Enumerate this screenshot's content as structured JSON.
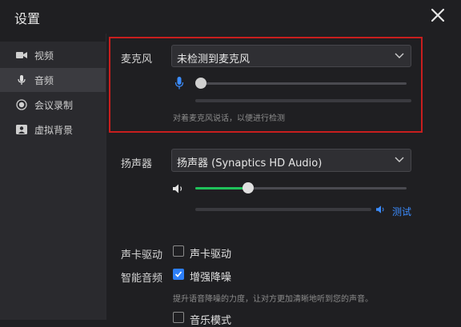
{
  "window": {
    "title": "设置"
  },
  "sidebar": {
    "items": [
      {
        "label": "视频",
        "icon": "video-camera-icon",
        "active": false
      },
      {
        "label": "音频",
        "icon": "microphone-icon",
        "active": true
      },
      {
        "label": "会议录制",
        "icon": "record-icon",
        "active": false
      },
      {
        "label": "虚拟背景",
        "icon": "portrait-icon",
        "active": false
      }
    ]
  },
  "microphone": {
    "label": "麦克风",
    "selected": "未检测到麦克风",
    "level": 0,
    "hint": "对着麦克风说话，以便进行检测"
  },
  "speaker": {
    "label": "扬声器",
    "selected": "扬声器 (Synaptics HD Audio)",
    "volume": 0.25,
    "test_label": "测试"
  },
  "sound_card": {
    "label": "声卡驱动",
    "checkbox_label": "声卡驱动",
    "checked": false
  },
  "smart_audio": {
    "label": "智能音频",
    "checkbox_label": "增强降噪",
    "checked": true,
    "hint": "提升语音降噪的力度，让对方更加清晰地听到您的声音。"
  },
  "music_mode": {
    "checkbox_label": "音乐模式",
    "checked": false
  },
  "colors": {
    "accent": "#2d7ff9",
    "slider_fill": "#1fc25a",
    "highlight": "#c81e1e"
  }
}
